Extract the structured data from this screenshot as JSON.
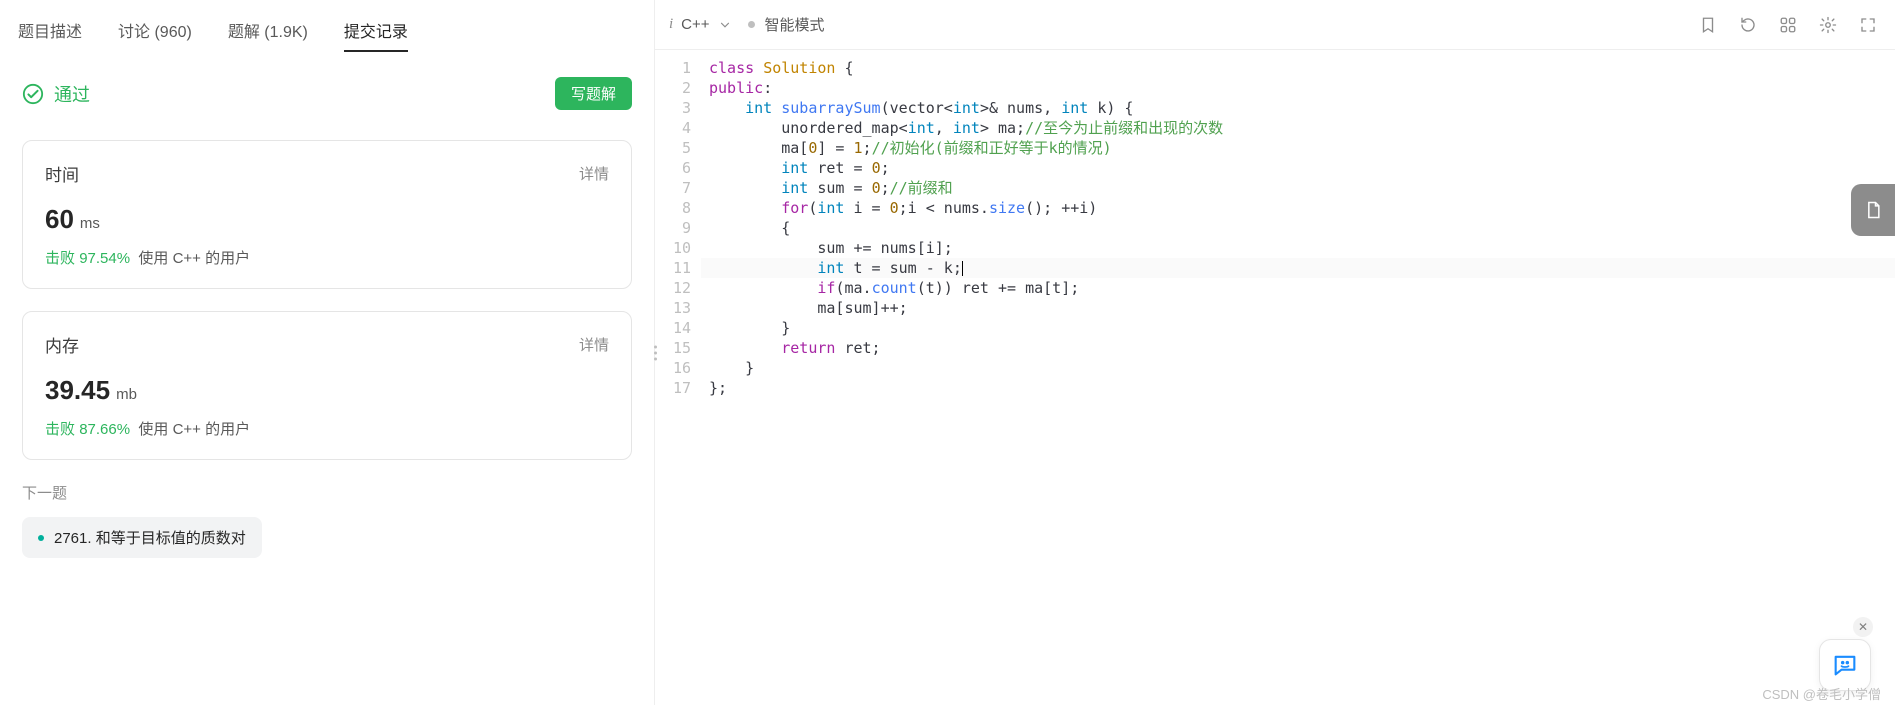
{
  "tabs": {
    "t0": "题目描述",
    "t1": "讨论 (960)",
    "t2": "题解 (1.9K)",
    "t3": "提交记录"
  },
  "status": {
    "label": "通过",
    "write_btn": "写题解"
  },
  "time_card": {
    "title": "时间",
    "detail": "详情",
    "value": "60",
    "unit": "ms",
    "beat_prefix": "击败",
    "beat_pct": "97.54%",
    "beat_suffix": "使用 C++ 的用户"
  },
  "mem_card": {
    "title": "内存",
    "detail": "详情",
    "value": "39.45",
    "unit": "mb",
    "beat_prefix": "击败",
    "beat_pct": "87.66%",
    "beat_suffix": "使用 C++ 的用户"
  },
  "next": {
    "label": "下一题",
    "item": "2761. 和等于目标值的质数对"
  },
  "toolbar": {
    "lang": "C++",
    "mode": "智能模式"
  },
  "code_lines": [
    {
      "n": "1",
      "html": "<span class='tok-kw'>class</span> <span class='tok-type'>Solution</span> {"
    },
    {
      "n": "2",
      "html": "<span class='tok-kw'>public</span>:"
    },
    {
      "n": "3",
      "html": "    <span class='tok-kw2'>int</span> <span class='tok-fn'>subarraySum</span>(vector&lt;<span class='tok-kw2'>int</span>&gt;&amp; nums, <span class='tok-kw2'>int</span> k) {"
    },
    {
      "n": "4",
      "html": "        unordered_map&lt;<span class='tok-kw2'>int</span>, <span class='tok-kw2'>int</span>&gt; ma;<span class='tok-cm'>//至今为止前缀和出现的次数</span>"
    },
    {
      "n": "5",
      "html": "        ma[<span class='tok-num'>0</span>] = <span class='tok-num'>1</span>;<span class='tok-cm'>//初始化(前缀和正好等于k的情况)</span>"
    },
    {
      "n": "6",
      "html": "        <span class='tok-kw2'>int</span> ret = <span class='tok-num'>0</span>;"
    },
    {
      "n": "7",
      "html": "        <span class='tok-kw2'>int</span> sum = <span class='tok-num'>0</span>;<span class='tok-cm'>//前缀和</span>"
    },
    {
      "n": "8",
      "html": "        <span class='tok-kw'>for</span>(<span class='tok-kw2'>int</span> i = <span class='tok-num'>0</span>;i &lt; nums.<span class='tok-fn'>size</span>(); ++i)"
    },
    {
      "n": "9",
      "html": "        {"
    },
    {
      "n": "10",
      "html": "            sum += nums[i];"
    },
    {
      "n": "11",
      "html": "            <span class='tok-kw2'>int</span> t = sum - k;<span class='cursor'></span>",
      "current": true
    },
    {
      "n": "12",
      "html": "            <span class='tok-kw'>if</span>(ma.<span class='tok-fn'>count</span>(t)) ret += ma[t];"
    },
    {
      "n": "13",
      "html": "            ma[sum]++;"
    },
    {
      "n": "14",
      "html": "        }"
    },
    {
      "n": "15",
      "html": "        <span class='tok-kw'>return</span> ret;"
    },
    {
      "n": "16",
      "html": "    }"
    },
    {
      "n": "17",
      "html": "};"
    }
  ],
  "watermark": "CSDN @卷毛小学僧"
}
